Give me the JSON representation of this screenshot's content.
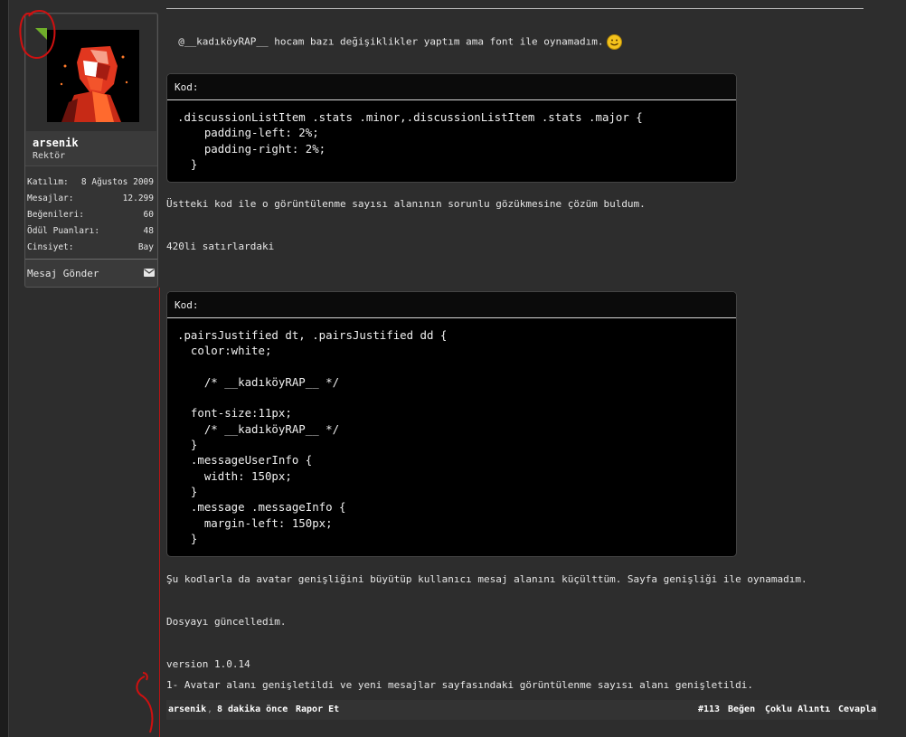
{
  "user": {
    "name": "arsenik",
    "title": "Rektör",
    "stats": [
      {
        "label": "Katılım:",
        "value": "8 Ağustos 2009"
      },
      {
        "label": "Mesajlar:",
        "value": "12.299"
      },
      {
        "label": "Beğenileri:",
        "value": "60"
      },
      {
        "label": "Ödül Puanları:",
        "value": "48"
      },
      {
        "label": "Cinsiyet:",
        "value": "Bay"
      }
    ],
    "send_message": "Mesaj Gönder"
  },
  "post": {
    "intro": "@__kadıköyRAP__ hocam bazı değişiklikler yaptım ama font ile oynamadım.",
    "code1_label": "Kod:",
    "code1": ".discussionListItem .stats .minor,.discussionListItem .stats .major {\n    padding-left: 2%;\n    padding-right: 2%;\n  }",
    "p1": "Üstteki kod ile o görüntülenme sayısı alanının sorunlu gözükmesine çözüm buldum.",
    "p2": "420li satırlardaki",
    "code2_label": "Kod:",
    "code2": ".pairsJustified dt, .pairsJustified dd {\n  color:white;\n\n    /* __kadıköyRAP__ */\n\n  font-size:11px;\n    /* __kadıköyRAP__ */\n  }\n  .messageUserInfo {\n    width: 150px;\n  }\n  .message .messageInfo {\n    margin-left: 150px;\n  }",
    "p3": "Şu kodlarla da avatar genişliğini büyütüp kullanıcı mesaj alanını küçülttüm. Sayfa genişliği ile oynamadım.",
    "p4": "Dosyayı güncelledim.",
    "p5": "version 1.0.14",
    "p6": "1- Avatar alanı genişletildi ve yeni mesajlar sayfasındaki görüntülenme sayısı alanı genişletildi."
  },
  "footer": {
    "author": "arsenik",
    "time": "8 dakika önce",
    "report": "Rapor Et",
    "post_number": "#113",
    "like": "Beğen",
    "multi_quote": "Çoklu Alıntı",
    "reply": "Cevapla"
  },
  "colors": {
    "online": "#6fae2a",
    "annotation": "#d01010"
  }
}
